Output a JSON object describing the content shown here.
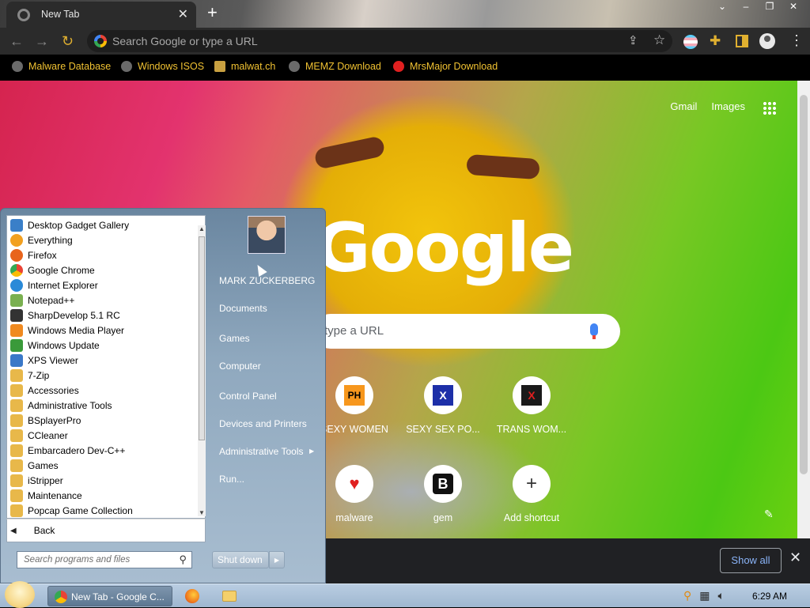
{
  "browser": {
    "tab_title": "New Tab",
    "omnibox_placeholder": "Search Google or type a URL",
    "bookmarks": [
      "Malware Database",
      "Windows ISOS",
      "malwat.ch",
      "MEMZ Download",
      "MrsMajor Download"
    ]
  },
  "newtab": {
    "links": [
      "Gmail",
      "Images"
    ],
    "logo": "Google",
    "search_placeholder": "type a URL",
    "shortcuts": [
      {
        "label": "SEXY WOMEN",
        "badge": "PH"
      },
      {
        "label": "SEXY SEX PO...",
        "badge": "X"
      },
      {
        "label": "TRANS WOM...",
        "badge": "X"
      },
      {
        "label": "malware",
        "badge": "♥"
      },
      {
        "label": "gem",
        "badge": "B"
      },
      {
        "label": "Add shortcut",
        "badge": "+"
      }
    ]
  },
  "downloads": {
    "show_all": "Show all"
  },
  "start_menu": {
    "programs": [
      "Desktop Gadget Gallery",
      "Everything",
      "Firefox",
      "Google Chrome",
      "Internet Explorer",
      "Notepad++",
      "SharpDevelop 5.1 RC",
      "Windows Media Player",
      "Windows Update",
      "XPS Viewer",
      "7-Zip",
      "Accessories",
      "Administrative Tools",
      "BSplayerPro",
      "CCleaner",
      "Embarcadero Dev-C++",
      "Games",
      "iStripper",
      "Maintenance",
      "Popcap Game Collection"
    ],
    "back_label": "Back",
    "search_placeholder": "Search programs and files",
    "right_items": [
      "MARK ZUCKERBERG",
      "Documents",
      "Games",
      "Computer",
      "Control Panel",
      "Devices and Printers",
      "Administrative Tools",
      "Run..."
    ],
    "shutdown_label": "Shut down"
  },
  "taskbar": {
    "active_window": "New Tab - Google C...",
    "clock": "6:29 AM"
  }
}
